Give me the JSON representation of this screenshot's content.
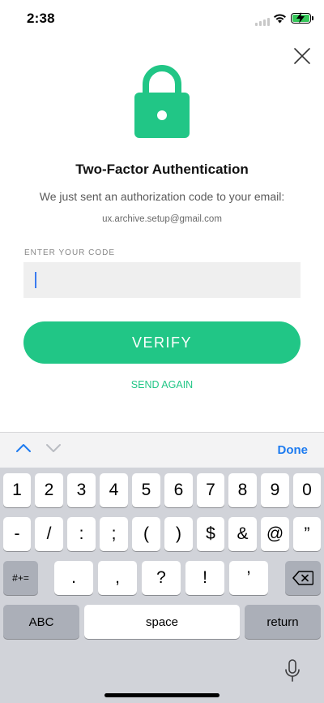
{
  "status_bar": {
    "time": "2:38"
  },
  "colors": {
    "accent": "#21c686",
    "input_bg": "#efefef",
    "link_blue": "#1d7bf0",
    "caret": "#3b7cf0",
    "battery": "#35c759"
  },
  "icons": {
    "lock": "lock-icon",
    "close": "close-icon",
    "mic": "microphone-icon",
    "backspace": "backspace-icon"
  },
  "content": {
    "title": "Two-Factor Authentication",
    "subtitle": "We just sent an authorization code to your email:",
    "email": "ux.archive.setup@gmail.com",
    "code_label": "ENTER YOUR CODE",
    "code_value": "",
    "verify_label": "VERIFY",
    "send_again_label": "SEND AGAIN"
  },
  "keyboard": {
    "done_label": "Done",
    "row1": [
      "1",
      "2",
      "3",
      "4",
      "5",
      "6",
      "7",
      "8",
      "9",
      "0"
    ],
    "row2": [
      "-",
      "/",
      ":",
      ";",
      "(",
      ")",
      "$",
      "&",
      "@",
      "”"
    ],
    "row3": [
      ".",
      ",",
      "?",
      "!",
      "’"
    ],
    "symbols_toggle": "#+=",
    "abc_label": "ABC",
    "space_label": "space",
    "return_label": "return"
  }
}
